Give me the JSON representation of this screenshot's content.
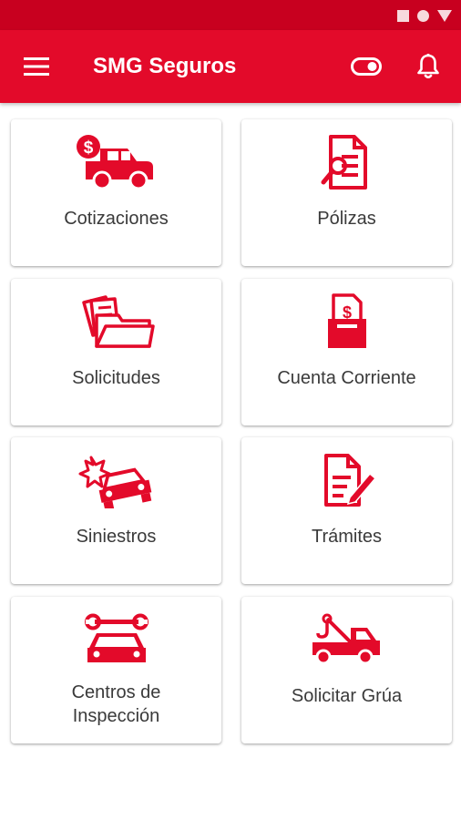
{
  "status_bar": {
    "icons": [
      "square-icon",
      "circle-icon",
      "triangle-icon"
    ]
  },
  "app_bar": {
    "title": "SMG Seguros",
    "menu_icon": "hamburger-menu-icon",
    "toggle_icon": "toggle-icon",
    "bell_icon": "bell-icon"
  },
  "colors": {
    "brand_red": "#e30a2a",
    "status_red": "#c8001f",
    "text": "#3a3a3a"
  },
  "tiles": [
    {
      "label": "Cotizaciones",
      "icon": "car-quote-icon"
    },
    {
      "label": "Pólizas",
      "icon": "policy-document-icon"
    },
    {
      "label": "Solicitudes",
      "icon": "folder-documents-icon"
    },
    {
      "label": "Cuenta Corriente",
      "icon": "account-ballot-icon"
    },
    {
      "label": "Siniestros",
      "icon": "car-crash-icon"
    },
    {
      "label": "Trámites",
      "icon": "document-edit-icon"
    },
    {
      "label": "Centros de",
      "label2": "Inspección",
      "icon": "car-wrench-icon"
    },
    {
      "label": "Solicitar Grúa",
      "icon": "tow-truck-icon"
    }
  ]
}
